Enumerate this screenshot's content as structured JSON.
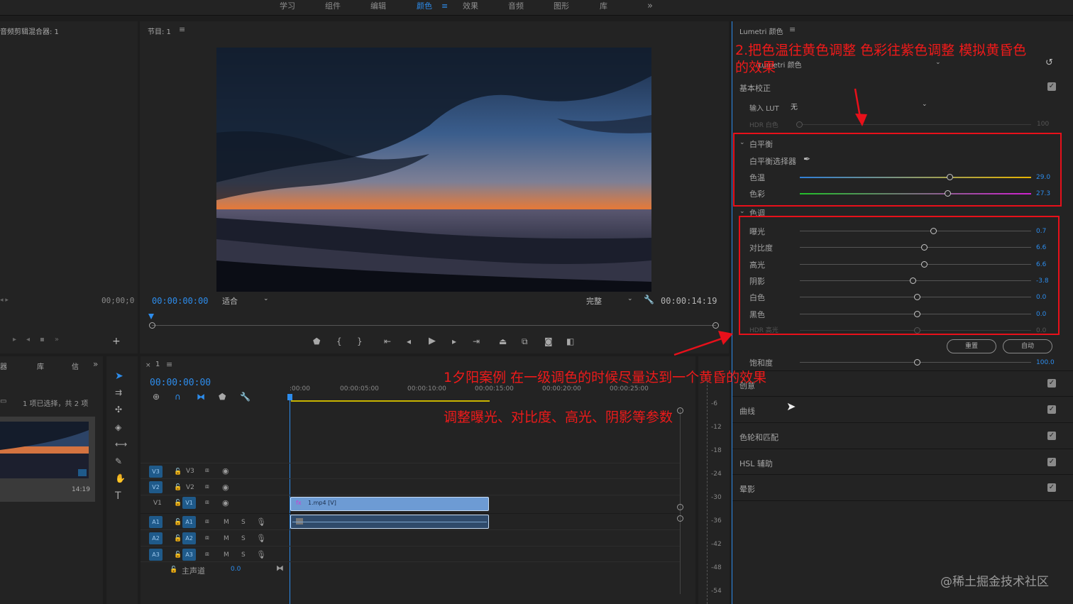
{
  "workspace_tabs": [
    {
      "label": "学习",
      "active": false
    },
    {
      "label": "组件",
      "active": false
    },
    {
      "label": "编辑",
      "active": false
    },
    {
      "label": "颜色",
      "active": true
    },
    {
      "label": "效果",
      "active": false
    },
    {
      "label": "音频",
      "active": false
    },
    {
      "label": "图形",
      "active": false
    },
    {
      "label": "库",
      "active": false
    }
  ],
  "workspace_more": "»",
  "workspace_menu": "≡",
  "audio_mixer": {
    "title": "音频剪辑混合器: 1",
    "timecode": "00;00;0"
  },
  "program_monitor": {
    "title": "节目: 1",
    "timecode_current": "00:00:00:00",
    "fit": "适合",
    "quality": "完整",
    "timecode_duration": "00:00:14:19"
  },
  "project_panel": {
    "tabs": [
      "器",
      "库",
      "信"
    ],
    "selection_info": "1 项已选择，共 2 项",
    "clip_duration": "14:19"
  },
  "timeline": {
    "title": "1",
    "timecode": "00:00:00:00",
    "ruler_ticks": [
      ":00:00",
      "00:00:05:00",
      "00:00:10:00",
      "00:00:15:00",
      "00:00:20:00",
      "00:00:25:00"
    ],
    "video_tracks": [
      {
        "src": "V3",
        "name": "V3"
      },
      {
        "src": "V2",
        "name": "V2"
      },
      {
        "src": "V1",
        "name": "V1"
      }
    ],
    "audio_tracks": [
      {
        "src": "A1",
        "name": "A1"
      },
      {
        "src": "A2",
        "name": "A2"
      },
      {
        "src": "A3",
        "name": "A3"
      }
    ],
    "track_m": "M",
    "track_s": "S",
    "master_label": "主声道",
    "master_value": "0.0",
    "clip_label": "1.mp4 [V]",
    "clip_fx": "fx"
  },
  "meter_ticks": [
    "-6",
    "-12",
    "-18",
    "-24",
    "-30",
    "-36",
    "-42",
    "-48",
    "-54"
  ],
  "lumetri": {
    "title": "Lumetri 颜色",
    "source": "Lumetri 颜色",
    "basic_correction": "基本校正",
    "input_lut_label": "输入 LUT",
    "input_lut_value": "无",
    "hdr_white_label": "HDR 白色",
    "hdr_white_value": "100",
    "white_balance": {
      "section": "白平衡",
      "picker_label": "白平衡选择器",
      "temperature": {
        "label": "色温",
        "value": "29.0",
        "fraction": 0.65
      },
      "tint": {
        "label": "色彩",
        "value": "27.3",
        "fraction": 0.64
      }
    },
    "tone": {
      "section": "色调",
      "sliders": [
        {
          "label": "曝光",
          "value": "0.7",
          "fraction": 0.58
        },
        {
          "label": "对比度",
          "value": "6.6",
          "fraction": 0.54
        },
        {
          "label": "高光",
          "value": "6.6",
          "fraction": 0.54
        },
        {
          "label": "阴影",
          "value": "-3.8",
          "fraction": 0.49
        },
        {
          "label": "白色",
          "value": "0.0",
          "fraction": 0.51
        },
        {
          "label": "黑色",
          "value": "0.0",
          "fraction": 0.51
        },
        {
          "label": "HDR 高光",
          "value": "0.0",
          "fraction": 0.51
        }
      ],
      "reset_label": "重置",
      "auto_label": "自动"
    },
    "saturation": {
      "label": "饱和度",
      "value": "100.0",
      "fraction": 0.51
    },
    "sections": [
      "创意",
      "曲线",
      "色轮和匹配",
      "HSL 辅助",
      "晕影"
    ]
  },
  "annotations": {
    "top": "2.把色温往黄色调整 色彩往紫色调整 模拟黄昏色的效果",
    "main": "1夕阳案例 在一级调色的时候尽量达到一个黄昏的效果",
    "sub": "调整曝光、对比度、高光、阴影等参数"
  },
  "watermark": "@稀土掘金技术社区",
  "colors": {
    "accent": "#2d8ceb",
    "annotation_red": "#e8101a",
    "temperature_left": "#2f7fd8",
    "temperature_right": "#e8b400",
    "tint_left": "#22c02a",
    "tint_right": "#d020d0"
  }
}
